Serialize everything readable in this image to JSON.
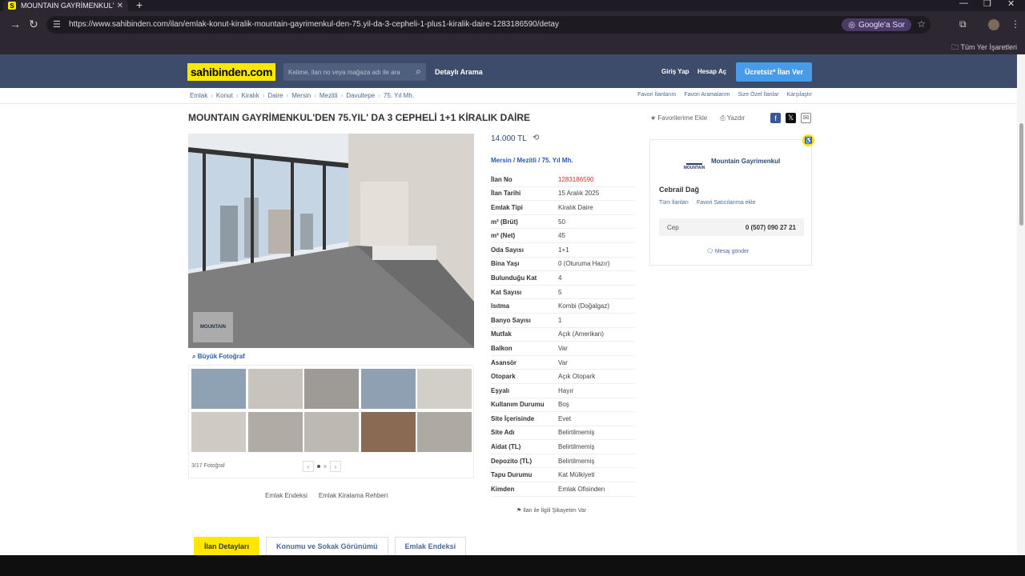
{
  "browser": {
    "tab_title": "MOUNTAIN GAYRİMENKUL'DEN",
    "url": "https://www.sahibinden.com/ilan/emlak-konut-kiralik-mountain-gayrimenkul-den-75.yil-da-3-cepheli-1-plus1-kiralik-daire-1283186590/detay",
    "google_button": "Google'a Sor",
    "bookmarks_all": "Tüm Yer İşaretleri"
  },
  "header": {
    "logo": "sahibinden.com",
    "search_placeholder": "Kelime, ilan no veya mağaza adı ile ara",
    "detailed_search": "Detaylı Arama",
    "login": "Giriş Yap",
    "register": "Hesap Aç",
    "post_ad": "Ücretsiz* İlan Ver"
  },
  "breadcrumb": {
    "items": [
      "Emlak",
      "Konut",
      "Kiralık",
      "Daire",
      "Mersin",
      "Mezitli",
      "Davultepe",
      "75. Yıl Mh."
    ],
    "right_links": [
      "Favori İlanlarım",
      "Favori Aramalarım",
      "Size Özel İlanlar",
      "Karşılaştır"
    ]
  },
  "listing": {
    "title": "MOUNTAIN GAYRİMENKUL'DEN 75.YIL' DA 3 CEPHELİ 1+1 KİRALIK DAİRE",
    "favorite": "Favorilerime Ekle",
    "print": "Yazdır",
    "price": "14.000 TL",
    "location": [
      "Mersin",
      "Mezitli",
      "75. Yıl Mh."
    ],
    "specs": [
      {
        "label": "İlan No",
        "value": "1283186590"
      },
      {
        "label": "İlan Tarihi",
        "value": "15 Aralık 2025"
      },
      {
        "label": "Emlak Tipi",
        "value": "Kiralık Daire"
      },
      {
        "label": "m² (Brüt)",
        "value": "50"
      },
      {
        "label": "m² (Net)",
        "value": "45"
      },
      {
        "label": "Oda Sayısı",
        "value": "1+1"
      },
      {
        "label": "Bina Yaşı",
        "value": "0 (Oturuma Hazır)"
      },
      {
        "label": "Bulunduğu Kat",
        "value": "4"
      },
      {
        "label": "Kat Sayısı",
        "value": "5"
      },
      {
        "label": "Isıtma",
        "value": "Kombi (Doğalgaz)"
      },
      {
        "label": "Banyo Sayısı",
        "value": "1"
      },
      {
        "label": "Mutfak",
        "value": "Açık (Amerikan)"
      },
      {
        "label": "Balkon",
        "value": "Var"
      },
      {
        "label": "Asansör",
        "value": "Var"
      },
      {
        "label": "Otopark",
        "value": "Açık Otopark"
      },
      {
        "label": "Eşyalı",
        "value": "Hayır"
      },
      {
        "label": "Kullanım Durumu",
        "value": "Boş"
      },
      {
        "label": "Site İçerisinde",
        "value": "Evet"
      },
      {
        "label": "Site Adı",
        "value": "Belirtilmemiş"
      },
      {
        "label": "Aidat (TL)",
        "value": "Belirtilmemiş"
      },
      {
        "label": "Depozito (TL)",
        "value": "Belirtilmemiş"
      },
      {
        "label": "Tapu Durumu",
        "value": "Kat Mülkiyeti"
      },
      {
        "label": "Kimden",
        "value": "Emlak Ofisinden"
      }
    ],
    "report": "İlan ile İlgili Şikayetim Var"
  },
  "gallery": {
    "photo_logo": "MOUNTAIN",
    "big_photo": "Büyük Fotoğraf",
    "counter": "3/17 Fotoğraf",
    "links": [
      "Emlak Endeksi",
      "Emlak Kiralama Rehberi"
    ]
  },
  "seller": {
    "logo_text": "MOUNTAIN",
    "store": "Mountain Gayrimenkul",
    "name": "Cebrail Dağ",
    "all_listings": "Tüm İlanları",
    "fav_seller": "Favori Satıcılarıma ekle",
    "phone_label": "Cep",
    "phone": "0 (507) 090 27 21",
    "message": "Mesaj gönder"
  },
  "tabs": [
    "İlan Detayları",
    "Konumu ve Sokak Görünümü",
    "Emlak Endeksi"
  ],
  "colors": {
    "brand_yellow": "#ffe800",
    "header_bg": "#3c4c6a",
    "accent_blue": "#489be8"
  }
}
